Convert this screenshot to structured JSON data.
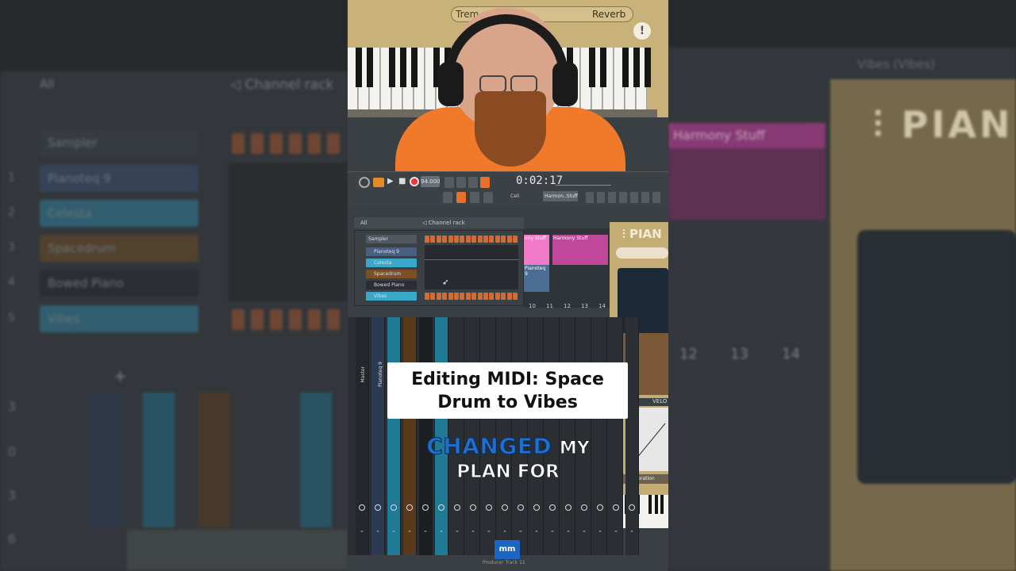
{
  "backdrop": {
    "browser_label": "All",
    "channel_rack_label": "Channel rack",
    "sampler_label": "Sampler",
    "channels": [
      {
        "num": "1",
        "name": "Pianoteq 9",
        "color": "#3a4d6e"
      },
      {
        "num": "2",
        "name": "Celesta",
        "color": "#2f7f9a"
      },
      {
        "num": "3",
        "name": "Spacedrum",
        "color": "#6a4a22"
      },
      {
        "num": "4",
        "name": "Bowed Piano",
        "color": "#24282c"
      },
      {
        "num": "5",
        "name": "Vibes",
        "color": "#2f7f9a"
      }
    ],
    "add_symbol": "+",
    "playlist_track": "Harmony Stuff",
    "plugin_title": "Vibes (Vibes)",
    "pianoteq_logo": "PIAN",
    "ruler": [
      "12",
      "13",
      "14"
    ],
    "mixer_numbers": [
      "3",
      "0",
      "3",
      "6"
    ],
    "mixer_label": "Master",
    "mixer_track": "Pianoteq 9"
  },
  "video": {
    "reverb_label": "Reverb",
    "tremolo_label": "Trem",
    "warning_symbol": "!",
    "transport_time": "0:02:17",
    "tempo": "94.000",
    "pattern_name": "Harmon..Stuff",
    "snap_label": "Cell",
    "rack_title": "Channel rack",
    "rack_filter": "All",
    "rack_sampler": "Sampler",
    "rack_channels": [
      {
        "num": "1",
        "name": "Pianoteq 9",
        "color": "#4a6080"
      },
      {
        "num": "2",
        "name": "Celesta",
        "color": "#3aa9c9"
      },
      {
        "num": "3",
        "name": "Spacedrum",
        "color": "#7a5024"
      },
      {
        "num": "4",
        "name": "Bowed Piano",
        "color": "#2a2d31"
      },
      {
        "num": "5",
        "name": "Vibes",
        "color": "#3aa9c9"
      }
    ],
    "playlist_clip1": "ony Stuff",
    "playlist_clip2": "Harmony Stuff",
    "playlist_clip3": "Pianoteq 9",
    "ruler": [
      "10",
      "11",
      "12",
      "13",
      "14"
    ],
    "pianoteq_logo": "PIAN",
    "velocity_label": "VELO",
    "calibration_label": "Calibration",
    "mixer_master": "Master",
    "mixer_track": "Pianoteq 9",
    "footer_text": "Producer  Track 11",
    "logo_text": "mm"
  },
  "overlay": {
    "title": "Editing MIDI: Space Drum to Vibes",
    "caption_highlight": "CHANGED",
    "caption_rest": "MY",
    "caption_line2": "PLAN FOR"
  },
  "colors": {
    "accent_orange": "#d26c33",
    "caption_blue": "#1d6fd0",
    "playlist_pink": "#c0489a"
  }
}
